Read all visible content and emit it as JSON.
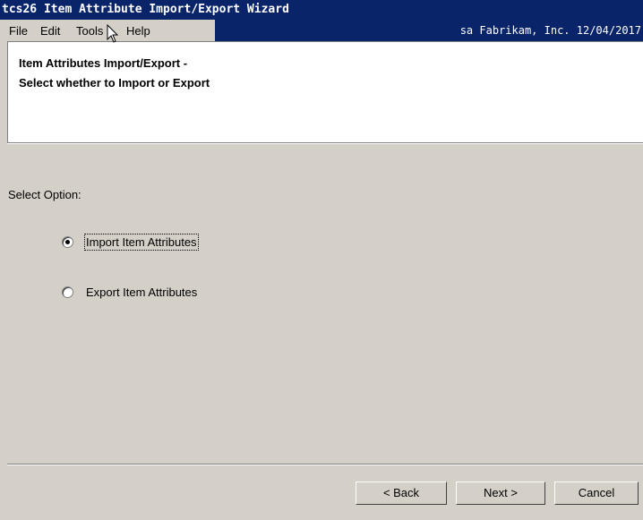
{
  "window": {
    "title": "tcs26 Item Attribute Import/Export Wizard"
  },
  "menu": {
    "items": [
      "File",
      "Edit",
      "Tools",
      "Help"
    ],
    "status": "sa  Fabrikam, Inc.  12/04/2017"
  },
  "header": {
    "line1": "Item Attributes Import/Export -",
    "line2": "Select whether to Import or Export"
  },
  "body": {
    "select_label": "Select Option:",
    "options": [
      {
        "label": "Import Item Attributes",
        "selected": true
      },
      {
        "label": "Export Item Attributes",
        "selected": false
      }
    ]
  },
  "buttons": {
    "back": "< Back",
    "next": "Next >",
    "cancel": "Cancel"
  },
  "colors": {
    "titlebar": "#0a246a",
    "dialog_bg": "#d4d0c8",
    "header_bg": "#ffffff"
  }
}
